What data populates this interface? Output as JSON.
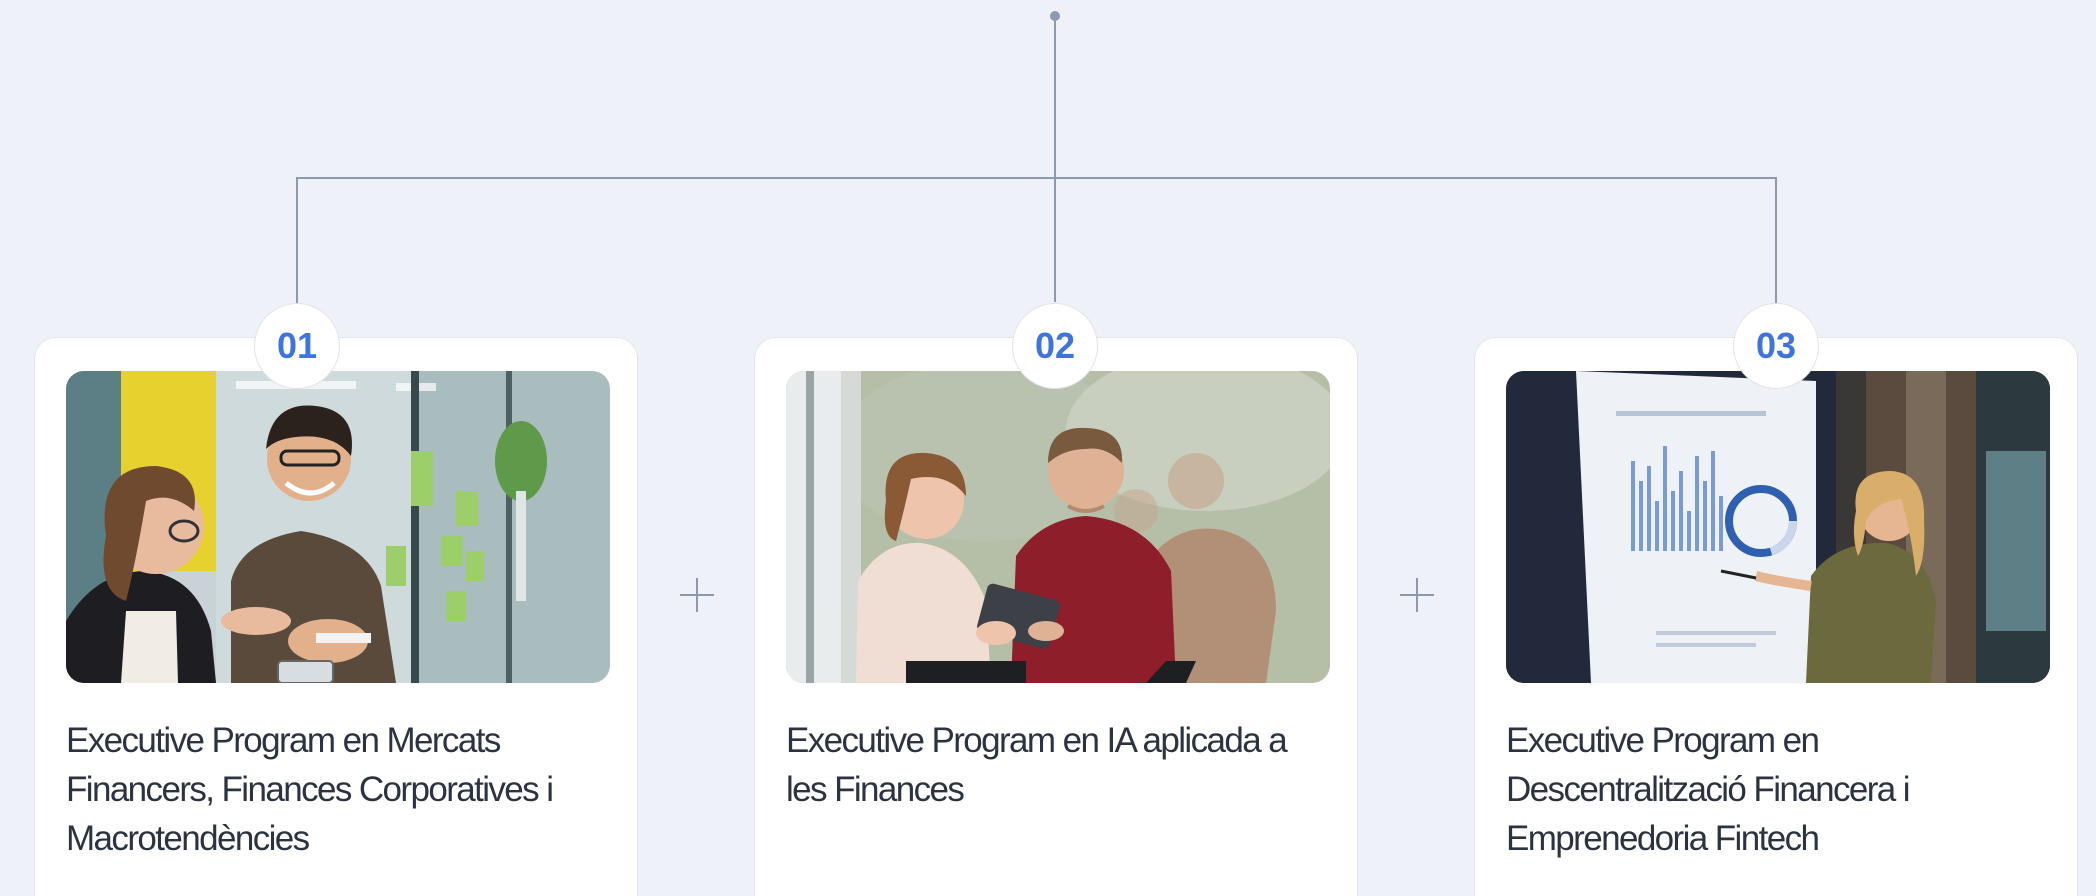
{
  "programs": [
    {
      "number": "01",
      "title": "Executive Program en Mercats Financers, Finances Corporatives i Macrotendències",
      "image": "office-team-glass-wall-photo"
    },
    {
      "number": "02",
      "title": "Executive Program en IA aplicada a les Finances",
      "image": "colleagues-with-tablet-photo"
    },
    {
      "number": "03",
      "title": "Executive Program en Descentralització Financera i Emprenedoria Fintech",
      "image": "presenter-at-dashboard-screen-photo"
    }
  ],
  "separator_icon": "plus-icon",
  "colors": {
    "background": "#eef2f8",
    "accent": "#3e73e0",
    "connector": "#8d9aab",
    "text": "#2b3340"
  }
}
